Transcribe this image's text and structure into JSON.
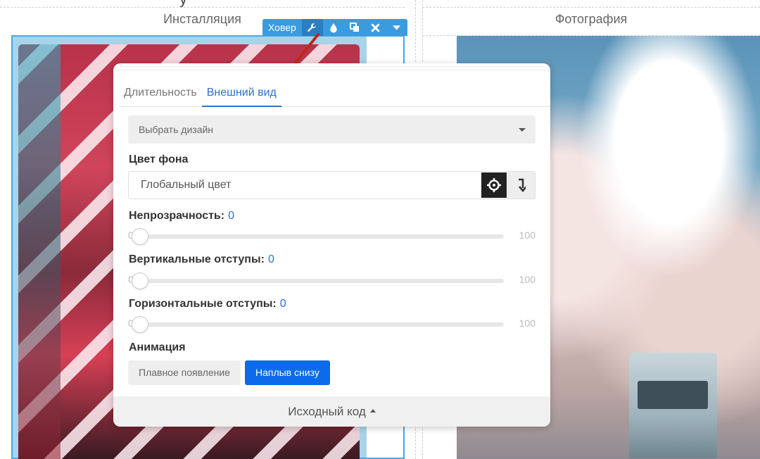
{
  "page": {
    "left_column_title": "Инсталляция",
    "right_column_title": "Фотография",
    "top_fragment": "у"
  },
  "hover_toolbar": {
    "label": "Ховер",
    "buttons": [
      {
        "name": "settings",
        "icon": "wrench-icon",
        "active": true
      },
      {
        "name": "color",
        "icon": "droplet-icon"
      },
      {
        "name": "duplicate",
        "icon": "copy-icon"
      },
      {
        "name": "remove",
        "icon": "close-icon"
      },
      {
        "name": "more",
        "icon": "caret-down-icon"
      }
    ],
    "color": "#3a9bdf"
  },
  "popover": {
    "tabs": [
      {
        "label": "Длительность",
        "active": false
      },
      {
        "label": "Внешний вид",
        "active": true
      }
    ],
    "design_select": {
      "value": "Выбрать дизайн"
    },
    "background": {
      "label": "Цвет фона",
      "value": "Глобальный цвет"
    },
    "opacity": {
      "label": "Непрозрачность:",
      "value": "0",
      "min": "0",
      "max": "100"
    },
    "vertical_padding": {
      "label": "Вертикальные отступы:",
      "value": "0",
      "min": "0",
      "max": "100"
    },
    "horizontal_padding": {
      "label": "Горизонтальные отступы:",
      "value": "0",
      "min": "0",
      "max": "100"
    },
    "animation": {
      "label": "Анимация",
      "options": [
        {
          "label": "Плавное появление",
          "active": false
        },
        {
          "label": "Наплыв снизу",
          "active": true
        }
      ]
    },
    "footer": {
      "label": "Исходный код"
    },
    "accent_color": "#2f6fd0",
    "active_button_color": "#0b6bea"
  },
  "annotation": {
    "arrow_color": "#c0271c"
  }
}
